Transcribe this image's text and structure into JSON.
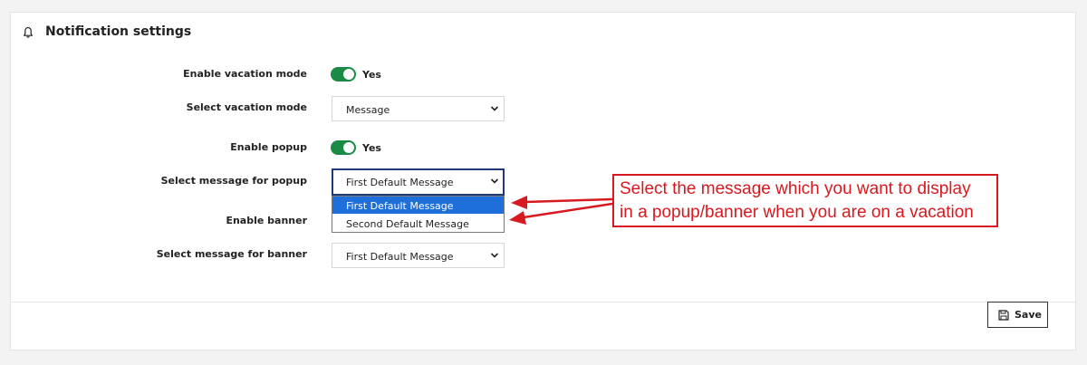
{
  "panel": {
    "title": "Notification settings",
    "title_icon": "bell-icon"
  },
  "rows": {
    "vacation_enable": {
      "label": "Enable vacation mode",
      "toggle_on": true,
      "toggle_text": "Yes"
    },
    "vacation_mode": {
      "label": "Select vacation mode",
      "value": "Message"
    },
    "popup_enable": {
      "label": "Enable popup",
      "toggle_on": true,
      "toggle_text": "Yes"
    },
    "popup_message": {
      "label": "Select message for popup",
      "value": "First Default Message",
      "options": [
        "First Default Message",
        "Second Default Message"
      ],
      "highlighted_option": "First Default Message"
    },
    "banner_enable": {
      "label": "Enable banner"
    },
    "banner_message": {
      "label": "Select message for banner",
      "value": "First Default Message"
    }
  },
  "footer": {
    "save_label": "Save",
    "save_icon": "floppy-disk-icon"
  },
  "annotation": {
    "line1": "Select the message which you want to display",
    "line2": "in a popup/banner when you are on a vacation",
    "color": "#d71920"
  },
  "colors": {
    "toggle_on": "#1a8a44",
    "focus_border": "#1f3a7a",
    "option_highlight": "#1e6fd9"
  }
}
